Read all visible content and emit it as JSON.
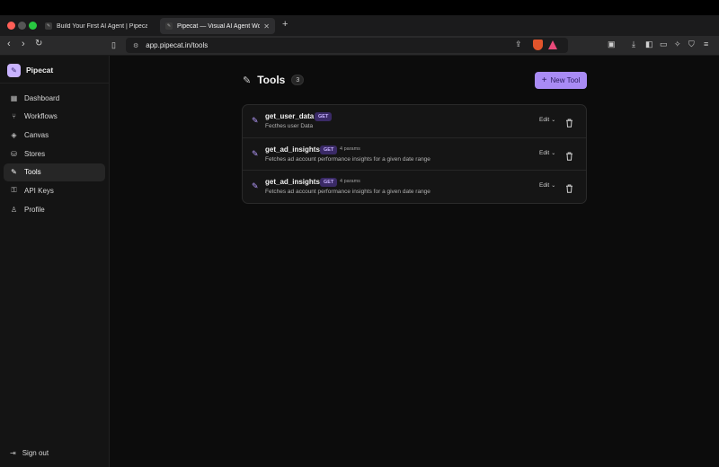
{
  "browser": {
    "tabs": [
      {
        "title": "Build Your First AI Agent | Pipecat",
        "active": false
      },
      {
        "title": "Pipecat — Visual AI Agent Wo",
        "active": true
      }
    ],
    "url": "app.pipecat.in/tools"
  },
  "sidebar": {
    "brand": "Pipecat",
    "items": [
      {
        "label": "Dashboard",
        "icon": "grid-icon",
        "active": false
      },
      {
        "label": "Workflows",
        "icon": "workflow-icon",
        "active": false
      },
      {
        "label": "Canvas",
        "icon": "layers-icon",
        "active": false
      },
      {
        "label": "Stores",
        "icon": "database-icon",
        "active": false
      },
      {
        "label": "Tools",
        "icon": "wrench-icon",
        "active": true
      },
      {
        "label": "API Keys",
        "icon": "key-icon",
        "active": false
      },
      {
        "label": "Profile",
        "icon": "user-icon",
        "active": false
      }
    ],
    "signout": "Sign out"
  },
  "main": {
    "title": "Tools",
    "count": "3",
    "new_button": "New Tool",
    "edit_label": "Edit",
    "tools": [
      {
        "name": "get_user_data",
        "method": "GET",
        "params": "",
        "description": "Fecthes user Data"
      },
      {
        "name": "get_ad_insights",
        "method": "GET",
        "params": "4 params",
        "description": "Fetches ad account performance insights for a given date range"
      },
      {
        "name": "get_ad_insights",
        "method": "GET",
        "params": "4 params",
        "description": "Fetches ad account performance insights for a given date range"
      }
    ]
  },
  "colors": {
    "accent": "#a98bf5",
    "method_badge_bg": "#3a2a66",
    "background": "#0c0c0c"
  }
}
